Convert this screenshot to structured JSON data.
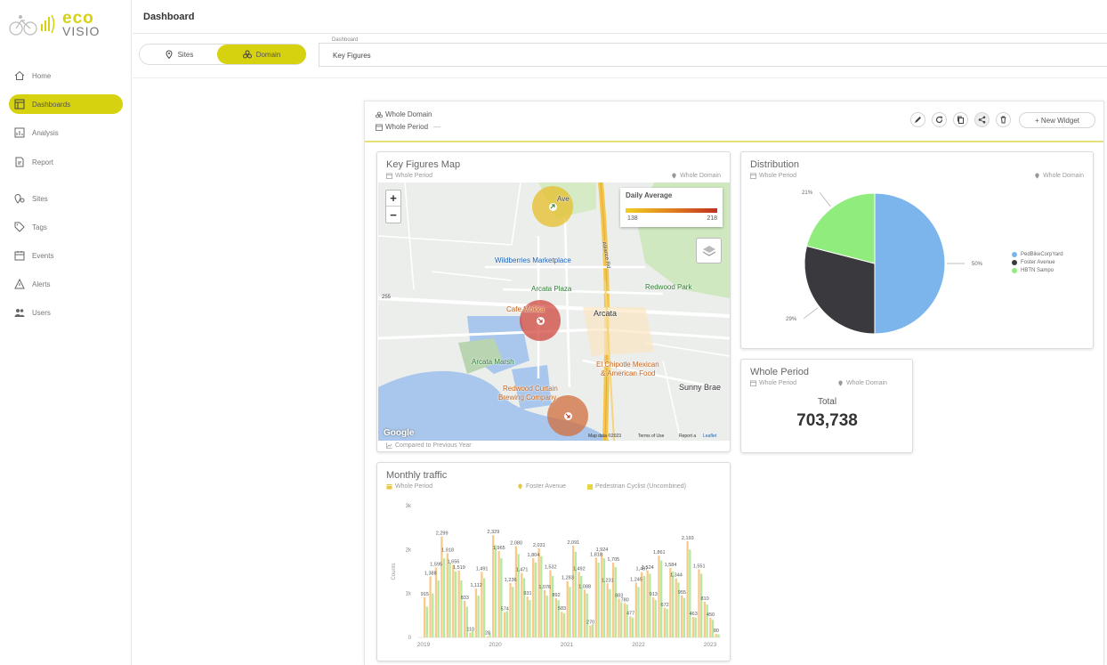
{
  "app": {
    "logo_top": "eco",
    "logo_bottom": "VISIO",
    "brand_color": "#d6d20f"
  },
  "sidebar": {
    "items": [
      {
        "label": "Home",
        "icon": "home-icon"
      },
      {
        "label": "Dashboards",
        "icon": "dashboard-icon",
        "active": true
      },
      {
        "label": "Analysis",
        "icon": "analysis-icon"
      },
      {
        "label": "Report",
        "icon": "report-icon"
      },
      {
        "label": "Sites",
        "icon": "sites-icon"
      },
      {
        "label": "Tags",
        "icon": "tag-icon"
      },
      {
        "label": "Events",
        "icon": "calendar-icon"
      },
      {
        "label": "Alerts",
        "icon": "alert-icon"
      },
      {
        "label": "Users",
        "icon": "users-icon"
      }
    ]
  },
  "header": {
    "title": "Dashboard"
  },
  "scope": {
    "sites_label": "Sites",
    "domain_label": "Domain",
    "active": "domain"
  },
  "dashboard_select": {
    "label": "Dashboard",
    "value": "Key Figures"
  },
  "dashboard": {
    "scope_line": "Whole Domain",
    "period_line": "Whole Period",
    "period_suffix": "—",
    "new_widget_label": "+ New Widget"
  },
  "map_widget": {
    "title": "Key Figures Map",
    "period": "Whole Period",
    "scope": "Whole Domain",
    "legend_title": "Daily Average",
    "legend_min": "138",
    "legend_max": "218",
    "zoom_in": "+",
    "zoom_out": "−",
    "places": {
      "wildberries": "Wildberries Marketplace",
      "plaza": "Arcata Plaza",
      "redwood_park": "Redwood Park",
      "cafe": "Cafe Mokka",
      "arcata": "Arcata",
      "marsh": "Arcata Marsh",
      "chipotle_1": "El Chipotle Mexican",
      "chipotle_2": "& American Food",
      "sunny_brae": "Sunny Brae",
      "curtain_1": "Redwood Curtain",
      "curtain_2": "Brewing Company",
      "ave": "Ave",
      "highway": "Alliance Rd",
      "route": "255"
    },
    "google": "Google",
    "map_data": "Map data ©2023",
    "terms": "Terms of Use",
    "report": "Report a",
    "leaflet": "Leaflet",
    "compared": "Compared to Previous Year"
  },
  "distribution_widget": {
    "title": "Distribution",
    "period": "Whole Period",
    "scope": "Whole Domain"
  },
  "total_widget": {
    "title": "Whole Period",
    "period": "Whole Period",
    "scope": "Whole Domain",
    "label": "Total",
    "value": "703,738"
  },
  "monthly_widget": {
    "title": "Monthly traffic",
    "period": "Whole Period",
    "legend_site": "Foster Avenue",
    "legend_series": "Pedestrian Cyclist (Uncombined)"
  },
  "chart_data": [
    {
      "type": "pie",
      "title": "Distribution",
      "labels": [
        "PedBikeCorpYard",
        "Foster Avenue",
        "HBTN Sampo"
      ],
      "values": [
        50,
        29,
        21
      ],
      "value_labels": [
        "50%",
        "29%",
        "21%"
      ],
      "colors": [
        "#7cb5ec",
        "#3a3a3e",
        "#90ed7d"
      ],
      "legend_position": "right"
    },
    {
      "type": "bar",
      "title": "Monthly traffic",
      "ylabel": "Counts",
      "ylim": [
        0,
        3000
      ],
      "yticks": [
        0,
        1000,
        2000,
        3000
      ],
      "ytick_labels": [
        "0",
        "1k",
        "2k",
        "3k"
      ],
      "xticks": [
        "2019",
        "2020",
        "2021",
        "2022",
        "2023"
      ],
      "grid": false,
      "legend_position": "top-right",
      "series": [
        {
          "name": "Foster Avenue",
          "color": "#f7c98a",
          "values": [
            915,
            1388,
            1595,
            2299,
            1918,
            1656,
            1519,
            833,
            110,
            1112,
            1491,
            28,
            2329,
            1965,
            574,
            1236,
            2080,
            1471,
            931,
            1804,
            2031,
            1076,
            1532,
            892,
            583,
            1283,
            2091,
            1492,
            1088,
            270,
            1818,
            1924,
            1231,
            1705,
            883,
            780,
            477,
            1245,
            1487,
            1524,
            913,
            1861,
            672,
            1584,
            1344,
            955,
            2193,
            463,
            1551,
            810,
            450,
            80
          ]
        },
        {
          "name": "Pedestrian Cyclist (Uncombined)",
          "color": "#b5e8a0",
          "values": [
            700,
            1000,
            1300,
            1800,
            1700,
            1500,
            1300,
            700,
            150,
            950,
            1350,
            100,
            2100,
            1800,
            600,
            1150,
            1900,
            1350,
            850,
            1700,
            1850,
            950,
            1400,
            850,
            550,
            1150,
            1950,
            1400,
            1000,
            300,
            1700,
            1800,
            1100,
            1600,
            800,
            750,
            450,
            1150,
            1400,
            1450,
            850,
            1750,
            650,
            1500,
            1250,
            900,
            2000,
            450,
            1450,
            750,
            400,
            70
          ]
        }
      ],
      "value_labels": [
        "915",
        "1,388",
        "1,595",
        "2,299",
        "1,918",
        "1,656",
        "1,519",
        "833",
        "110",
        "1,112",
        "1,491",
        "28",
        "2,329",
        "1,965",
        "574",
        "1,236",
        "2,080",
        "1,471",
        "931",
        "1,804",
        "2,031",
        "1,076",
        "1,532",
        "892",
        "583",
        "1,283",
        "2,091",
        "1,492",
        "1,088",
        "270",
        "1,818",
        "1,924",
        "1,231",
        "1,705",
        "883",
        "780",
        "477",
        "1,245",
        "1,487",
        "1,524",
        "913",
        "1,861",
        "672",
        "1,584",
        "1,344",
        "955",
        "2,193",
        "463",
        "1,551",
        "810",
        "450",
        "80"
      ]
    }
  ]
}
